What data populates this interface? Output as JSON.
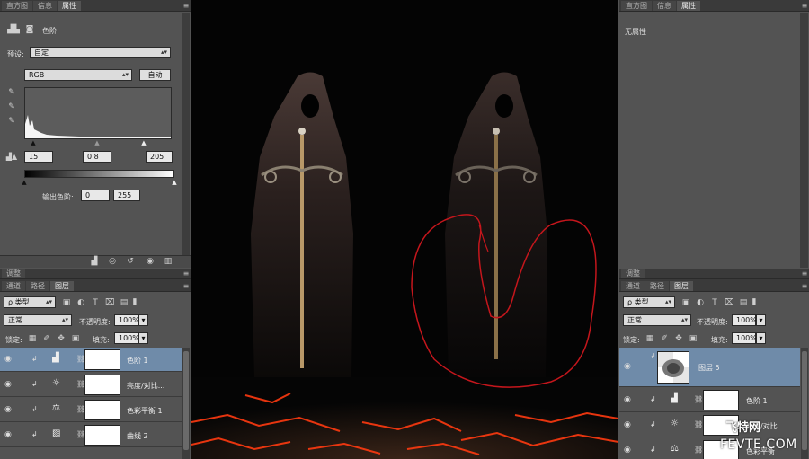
{
  "left_props": {
    "tabs": [
      "直方图",
      "信息",
      "属性"
    ],
    "active_tab": 2,
    "title": "色阶",
    "preset_label": "预设:",
    "preset_value": "自定",
    "channel_value": "RGB",
    "auto_label": "自动",
    "input_shadow": "15",
    "input_mid": "0.8",
    "input_highlight": "205",
    "output_label": "输出色阶:",
    "output_low": "0",
    "output_high": "255"
  },
  "left_layers": {
    "top_tab": "调整",
    "tabs": [
      "通道",
      "路径",
      "图层"
    ],
    "active_tab": 2,
    "filter_value": "类型",
    "blend_mode": "正常",
    "opacity_label": "不透明度:",
    "opacity_value": "100%",
    "lock_label": "锁定:",
    "fill_label": "填充:",
    "fill_value": "100%",
    "layers": [
      {
        "name": "色阶 1",
        "icon": "levels-icon",
        "glyph": "▟",
        "selected": true
      },
      {
        "name": "亮度/对比...",
        "icon": "brightness-icon",
        "glyph": "☼",
        "selected": false
      },
      {
        "name": "色彩平衡 1",
        "icon": "balance-icon",
        "glyph": "⚖",
        "selected": false
      },
      {
        "name": "曲线 2",
        "icon": "curves-icon",
        "glyph": "▨",
        "selected": false
      }
    ]
  },
  "right_props": {
    "tabs": [
      "直方图",
      "信息",
      "属性"
    ],
    "active_tab": 2,
    "no_props": "无属性"
  },
  "right_layers": {
    "top_tab": "调整",
    "tabs": [
      "通道",
      "路径",
      "图层"
    ],
    "active_tab": 2,
    "filter_value": "类型",
    "blend_mode": "正常",
    "opacity_label": "不透明度:",
    "opacity_value": "100%",
    "lock_label": "锁定:",
    "fill_label": "填充:",
    "fill_value": "100%",
    "layers": [
      {
        "name": "图层 5",
        "type": "pixel",
        "selected": true
      },
      {
        "name": "色阶 1",
        "icon": "levels-icon",
        "glyph": "▟",
        "selected": false
      },
      {
        "name": "亮度/对比...",
        "icon": "brightness-icon",
        "glyph": "☼",
        "selected": false
      },
      {
        "name": "色彩平衡",
        "icon": "balance-icon",
        "glyph": "⚖",
        "selected": false
      }
    ]
  },
  "watermark": {
    "line1": "飞特网",
    "line2": "FEVTE.COM"
  },
  "colors": {
    "panel_bg": "#535353",
    "selected_row": "#6f8ba9",
    "selection_stroke": "#c4161c",
    "lava": "#ff3a10"
  }
}
